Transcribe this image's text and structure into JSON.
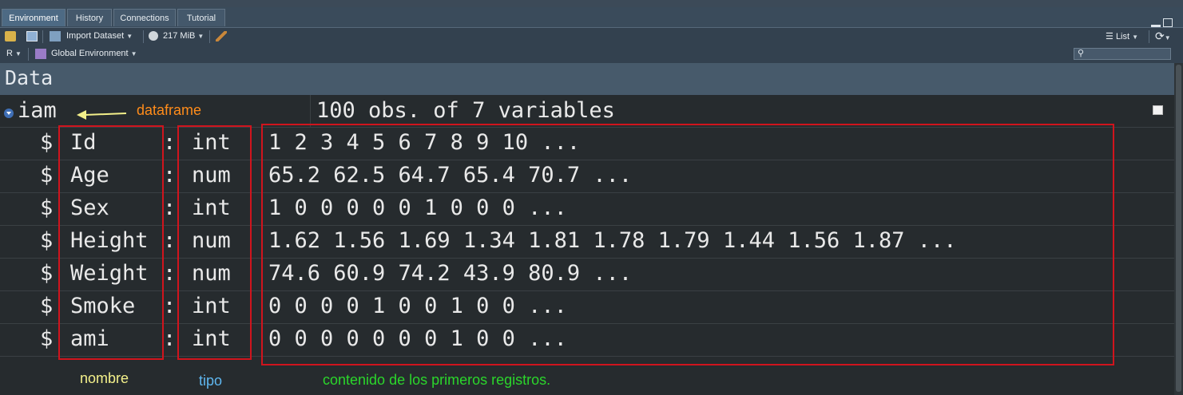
{
  "tabs": [
    {
      "label": "Environment",
      "active": true
    },
    {
      "label": "History",
      "active": false
    },
    {
      "label": "Connections",
      "active": false
    },
    {
      "label": "Tutorial",
      "active": false
    }
  ],
  "toolbar": {
    "import_label": "Import Dataset",
    "memory_label": "217 MiB",
    "view_label": "List"
  },
  "scope": {
    "language": "R",
    "environment": "Global Environment",
    "search_placeholder": ""
  },
  "section": {
    "title": "Data"
  },
  "object": {
    "name": "iam",
    "description": "100 obs. of 7 variables"
  },
  "variables": [
    {
      "dollar": "$",
      "name": "Id",
      "colon": ":",
      "type": "int",
      "values": "1 2 3 4 5 6 7 8 9 10 ..."
    },
    {
      "dollar": "$",
      "name": "Age",
      "colon": ":",
      "type": "num",
      "values": "65.2 62.5 64.7 65.4 70.7 ..."
    },
    {
      "dollar": "$",
      "name": "Sex",
      "colon": ":",
      "type": "int",
      "values": "1 0 0 0 0 0 1 0 0 0 ..."
    },
    {
      "dollar": "$",
      "name": "Height",
      "colon": ":",
      "type": "num",
      "values": "1.62 1.56 1.69 1.34 1.81 1.78 1.79 1.44 1.56 1.87 ..."
    },
    {
      "dollar": "$",
      "name": "Weight",
      "colon": ":",
      "type": "num",
      "values": "74.6 60.9 74.2 43.9 80.9 ..."
    },
    {
      "dollar": "$",
      "name": "Smoke",
      "colon": ":",
      "type": "int",
      "values": "0 0 0 0 1 0 0 1 0 0 ..."
    },
    {
      "dollar": "$",
      "name": "ami",
      "colon": ":",
      "type": "int",
      "values": "0 0 0 0 0 0 0 1 0 0 ..."
    }
  ],
  "annotations": {
    "dataframe": "dataframe",
    "nombre": "nombre",
    "tipo": "tipo",
    "contenido": "contenido de los primeros registros.",
    "colors": {
      "dataframe": "#ff8c1a",
      "nombre": "#f3f08a",
      "tipo": "#5fb7f0",
      "contenido": "#2bd62b",
      "box": "#d0141d",
      "arrow": "#f3f08a"
    }
  }
}
